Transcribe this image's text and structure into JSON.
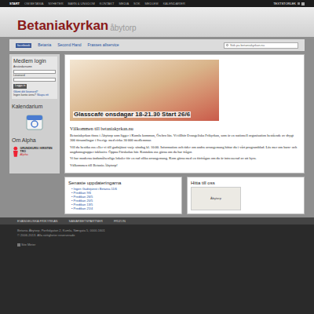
{
  "topnav": {
    "items": [
      {
        "label": "START",
        "selected": true
      },
      {
        "label": "OM BETANIA",
        "selected": false
      },
      {
        "label": "NYHETER",
        "selected": false
      },
      {
        "label": "BARN & UNGDOM",
        "selected": false
      },
      {
        "label": "KONTAKT",
        "selected": false
      },
      {
        "label": "MEDIA",
        "selected": false
      },
      {
        "label": "SÖK",
        "selected": false
      },
      {
        "label": "MEDLEM",
        "selected": false
      },
      {
        "label": "KALENDARIER",
        "selected": false
      }
    ],
    "textsize": "TEXTSTORLEK"
  },
  "header": {
    "title": "Betaniakyrkan",
    "subtitle": "åbytorp"
  },
  "links": {
    "facebook": "facebook",
    "items": [
      "Betania",
      "Second Hand",
      "Frasses allservice"
    ],
    "search_placeholder": "Sök på betaniakyrkan.nu"
  },
  "sidebar": {
    "login_title": "Medlem login",
    "username_label": "Användarnamn",
    "password_label": "Lösenord",
    "login_button": "Logga in",
    "forgot": "Glömt ditt lösenord?",
    "no_account": "Ingen konto ännu?",
    "create": "Skapa ett",
    "calendar_title": "Kalendarium",
    "alpha_title": "Om Alpha",
    "alpha_text": "GRUNDKURS I KRISTEN TRO",
    "alpha_logo": "Alpha"
  },
  "banner": {
    "text": "Glasscafé onsdagar 18-21.30  Start 26/6"
  },
  "content": {
    "heading": "Välkommen till betaniakyrkan.nu",
    "paragraphs": [
      "Betaniakyrkan finns i Åbytorp som ligger i Kumla kommun, Örebro län. Vi tillhör Evangeliska Frikyrkan, som är en nationell organisation bestående av drygt 300 församlingar i Sverige med cirka 30 000 medlemmar.",
      "Vill du besöka oss eller vi till gudstjänst varje söndag kl. 10.00. Information och tider om andra arrangemang hittar du i vårt programblad. Läs mer om barn- och ungdomsgrupper inklusive Öppna Förskolan här. Kontakta oss gärna om du har frågor.",
      "Vi har moderna ändamålsenliga lokaler för en rad olika arrangemang. Kom gärna med en förfrågan om du är intresserad av att hyra.",
      "Välkommen till Betania Åbytorp!"
    ]
  },
  "updates": {
    "title": "Senaste uppdateringarna",
    "items": [
      "Ingen Gudstjänst i Betania 11/6",
      "Predikan 9/6",
      "Predikan 26/5",
      "Predikan 20/5",
      "Predikan 13/5",
      "Predikan 21/4"
    ]
  },
  "map": {
    "title": "Hitta till oss",
    "place": "Åbytorp"
  },
  "footer": {
    "links": [
      "EVANGELISKA FRIKYRKAN",
      "SAMARBETSPARTNER",
      "FRIZON"
    ],
    "address": "Betania Åbytorp, Portfolgatan 2, Kumla, Nærgata 5, 0000-1601",
    "copyright": "© 2006-2013. Alla rättigheter reserverade",
    "sitemeter": "Site Meter"
  }
}
